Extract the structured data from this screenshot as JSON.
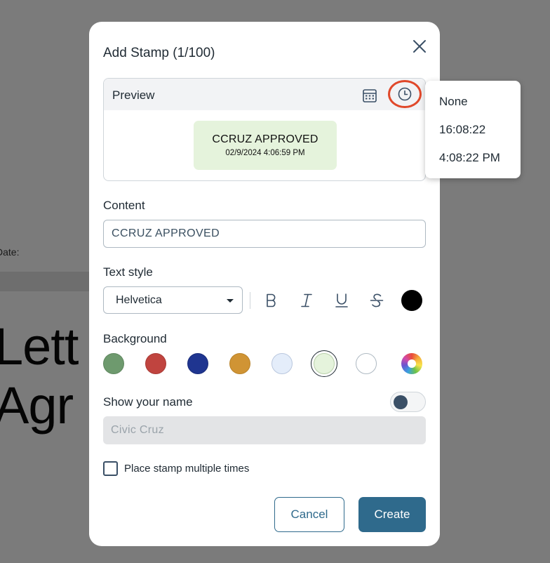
{
  "background_doc": {
    "date_label": "Date:",
    "heading": "Lett\nAgr"
  },
  "modal": {
    "title": "Add Stamp (1/100)",
    "close_icon": "close-icon"
  },
  "preview": {
    "label": "Preview",
    "calendar_icon": "calendar-icon",
    "clock_icon": "clock-icon",
    "stamp_content": "CCRUZ APPROVED",
    "stamp_date": "02/9/2024 4:06:59 PM",
    "stamp_background": "#e5f3dc"
  },
  "content": {
    "label": "Content",
    "value": "CCRUZ APPROVED"
  },
  "text_style": {
    "label": "Text style",
    "font_value": "Helvetica",
    "buttons": [
      {
        "name": "bold",
        "glyph": "B"
      },
      {
        "name": "italic",
        "glyph": "I"
      },
      {
        "name": "underline",
        "glyph": "U"
      },
      {
        "name": "strikethrough",
        "glyph": "S"
      }
    ],
    "text_color": "#000000"
  },
  "background": {
    "label": "Background",
    "swatches": [
      "#6e9a6e",
      "#c0443f",
      "#1f3590",
      "#d09434",
      "#e4edfa",
      "#e5f3dc",
      "#ffffff"
    ],
    "selected": "#e5f3dc",
    "custom_icon": "color-wheel-icon"
  },
  "show_name": {
    "label": "Show your name",
    "enabled": false,
    "name_value": "Civic Cruz"
  },
  "multiple": {
    "label": "Place stamp multiple times",
    "checked": false
  },
  "actions": {
    "cancel_label": "Cancel",
    "create_label": "Create"
  },
  "time_format_dropdown": {
    "options": [
      "None",
      "16:08:22",
      "4:08:22 PM"
    ]
  },
  "colors": {
    "accent": "#2f6a8c",
    "highlight_ring": "#e0482a",
    "overlay": "#7b7b7b"
  }
}
